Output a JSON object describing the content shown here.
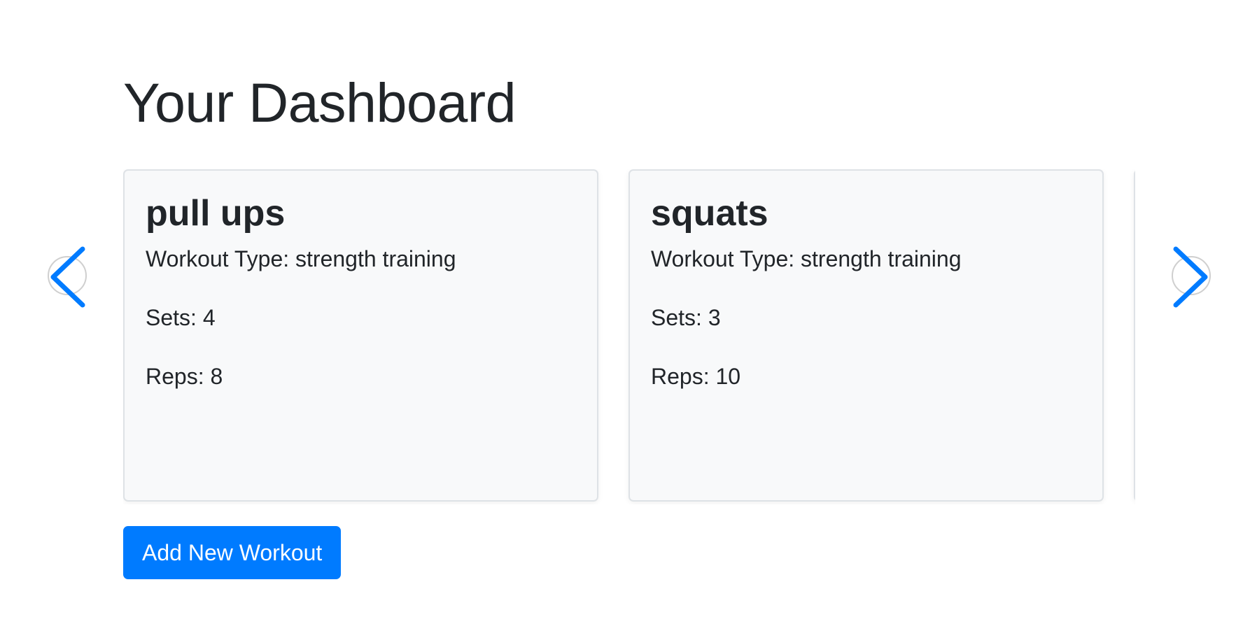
{
  "page": {
    "title": "Your Dashboard"
  },
  "carousel": {
    "prev_icon": "chevron-left-icon",
    "next_icon": "chevron-right-icon",
    "accent_color": "#007bff",
    "cards": [
      {
        "name": "pull ups",
        "type_line": "Workout Type: strength training",
        "sets_line": "Sets: 4",
        "reps_line": "Reps: 8"
      },
      {
        "name": "squats",
        "type_line": "Workout Type: strength training",
        "sets_line": "Sets: 3",
        "reps_line": "Reps: 10"
      }
    ]
  },
  "actions": {
    "add_workout_label": "Add New Workout",
    "button_color": "#007bff"
  }
}
